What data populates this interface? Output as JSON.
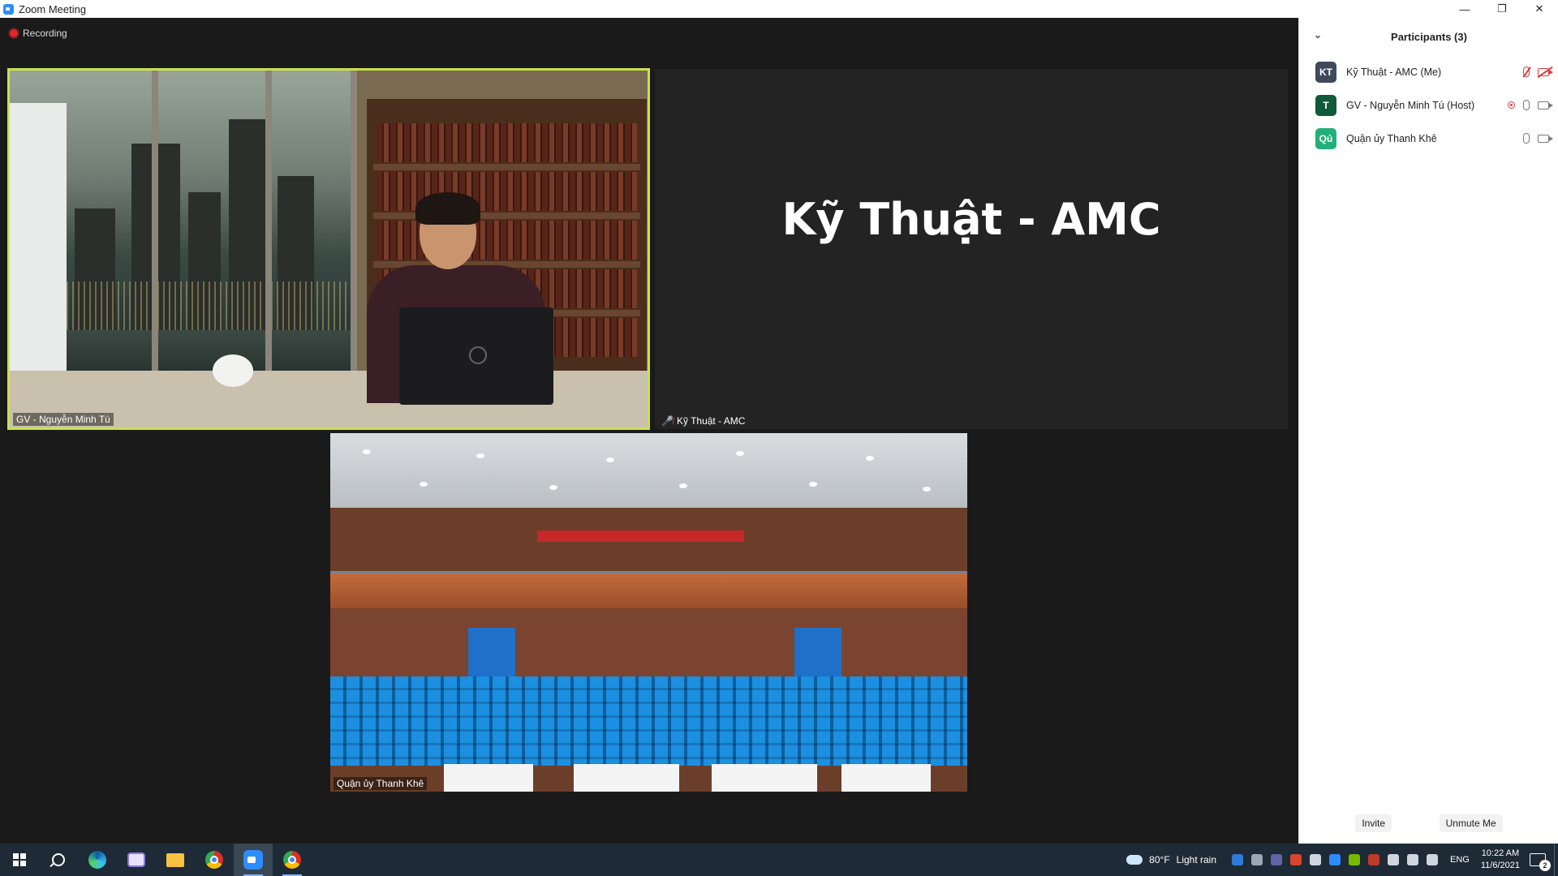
{
  "window": {
    "title": "Zoom Meeting",
    "controls": {
      "minimize": "—",
      "restore": "❐",
      "close": "✕"
    }
  },
  "meeting": {
    "recording_label": "Recording",
    "tiles": {
      "gv": {
        "name": "GV - Nguyễn Minh Tú"
      },
      "kt": {
        "display_name": "Kỹ Thuật - AMC",
        "name": "Kỹ Thuật - AMC"
      },
      "qu": {
        "name": "Quận ủy Thanh Khê"
      }
    }
  },
  "participants": {
    "title": "Participants (3)",
    "list": [
      {
        "initials": "KT",
        "name": "Kỹ Thuật - AMC (Me)",
        "avatar_color": "#3d4a5a"
      },
      {
        "initials": "T",
        "name": "GV - Nguyễn Minh Tú (Host)",
        "avatar_color": "#0f5a3a"
      },
      {
        "initials": "Qủ",
        "name": "Quận ủy Thanh Khê",
        "avatar_color": "#22b07a"
      }
    ],
    "invite_label": "Invite",
    "unmute_label": "Unmute Me"
  },
  "taskbar": {
    "apps": [
      "start",
      "search",
      "edge",
      "snipping-tool",
      "file-explorer",
      "chrome",
      "zoom",
      "chrome-profile"
    ],
    "weather": {
      "temp": "80°F",
      "condition": "Light rain"
    },
    "language": "ENG",
    "time": "10:22 AM",
    "date": "11/6/2021",
    "notification_count": "2"
  },
  "colors": {
    "active_speaker_border": "#c9e24a",
    "recording_red": "#e02828",
    "taskbar_bg": "#1e2a36"
  }
}
